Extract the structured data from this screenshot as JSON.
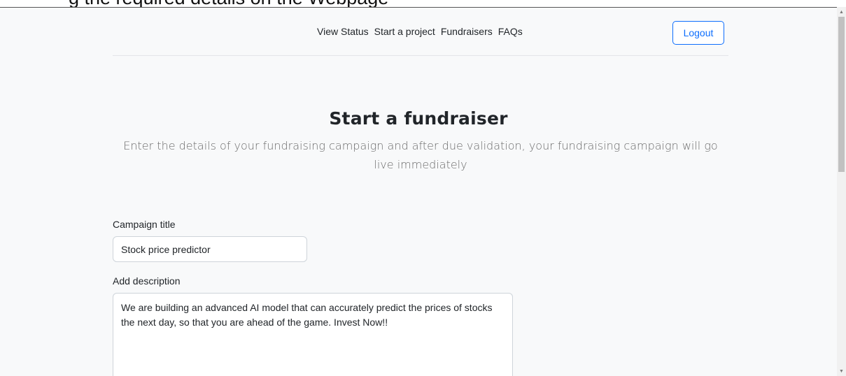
{
  "caption": {
    "text": "g the required details on the Webpage"
  },
  "nav": {
    "items": [
      {
        "label": "View Status"
      },
      {
        "label": "Start a project"
      },
      {
        "label": "Fundraisers"
      },
      {
        "label": "FAQs"
      }
    ],
    "logout_label": "Logout"
  },
  "hero": {
    "title": "Start a fundraiser",
    "lead": "Enter the details of your fundraising campaign and after due validation, your fundraising campaign will go live immediately"
  },
  "form": {
    "title_label": "Campaign title",
    "title_value": "Stock price predictor",
    "description_label": "Add description",
    "description_value": "We are building an advanced AI model that can accurately predict the prices of stocks the next day, so that you are ahead of the game. Invest Now!!"
  },
  "colors": {
    "page_background": "#f8f9fa",
    "primary": "#0d6efd",
    "text": "#212529",
    "muted": "#6c6c6c"
  },
  "icons": {
    "scroll_up": "triangle-up-icon",
    "scroll_down": "triangle-down-icon"
  }
}
